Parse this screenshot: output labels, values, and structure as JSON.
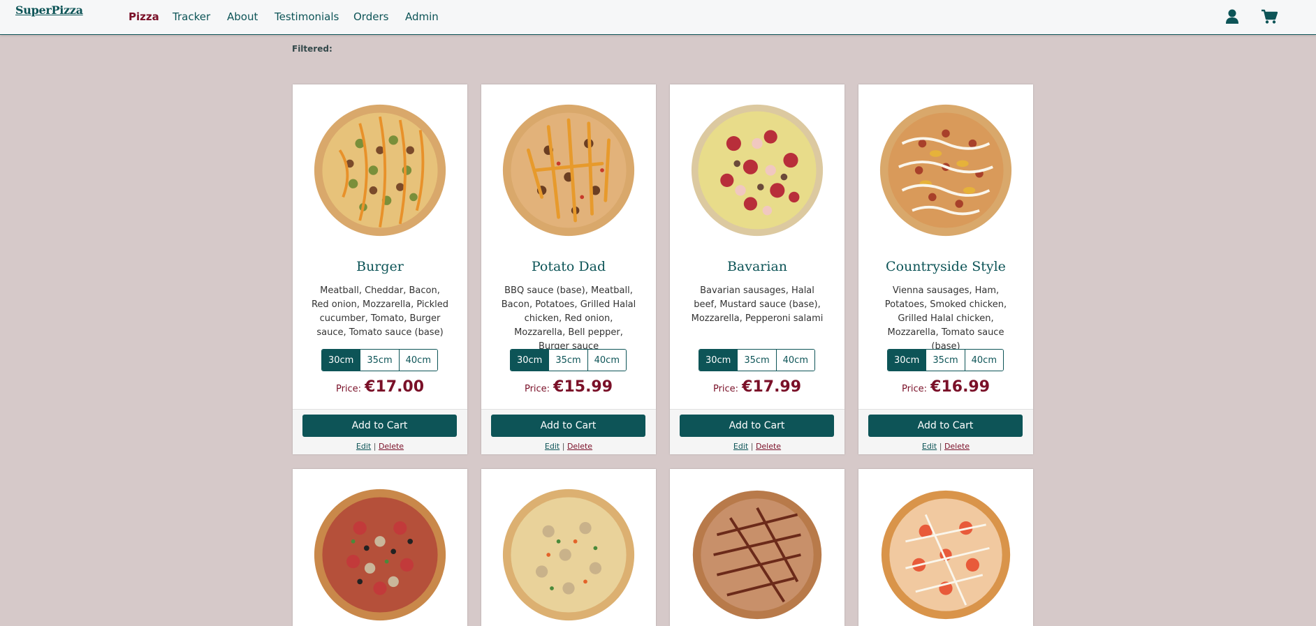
{
  "nav": {
    "brand": "SuperPizza",
    "links": [
      "Pizza",
      "Tracker",
      "About",
      "Testimonials",
      "Orders",
      "Admin"
    ],
    "active": "Pizza"
  },
  "filter": {
    "label": "Filtered:"
  },
  "labels": {
    "price": "Price:",
    "add_to_cart": "Add to Cart",
    "edit": "Edit",
    "separator": "|",
    "delete": "Delete"
  },
  "sizes": [
    "30cm",
    "35cm",
    "40cm"
  ],
  "selected_size": "30cm",
  "pizzas": [
    {
      "name": "Burger",
      "description": "Meatball, Cheddar, Bacon, Red onion, Mozzarella, Pickled cucumber, Tomato, Burger sauce, Tomato sauce (base)",
      "price": "€17.00"
    },
    {
      "name": "Potato Dad",
      "description": "BBQ sauce (base), Meatball, Bacon, Potatoes, Grilled Halal chicken, Red onion, Mozzarella, Bell pepper, Burger sauce",
      "price": "€15.99"
    },
    {
      "name": "Bavarian",
      "description": "Bavarian sausages, Halal beef, Mustard sauce (base), Mozzarella, Pepperoni salami",
      "price": "€17.99"
    },
    {
      "name": "Countryside Style",
      "description": "Vienna sausages, Ham, Potatoes, Smoked chicken, Grilled Halal chicken, Mozzarella, Tomato sauce (base)",
      "price": "€16.99"
    }
  ],
  "colors": {
    "primary": "#0d5457",
    "accent": "#7a1028",
    "background": "#d6c9c9"
  }
}
